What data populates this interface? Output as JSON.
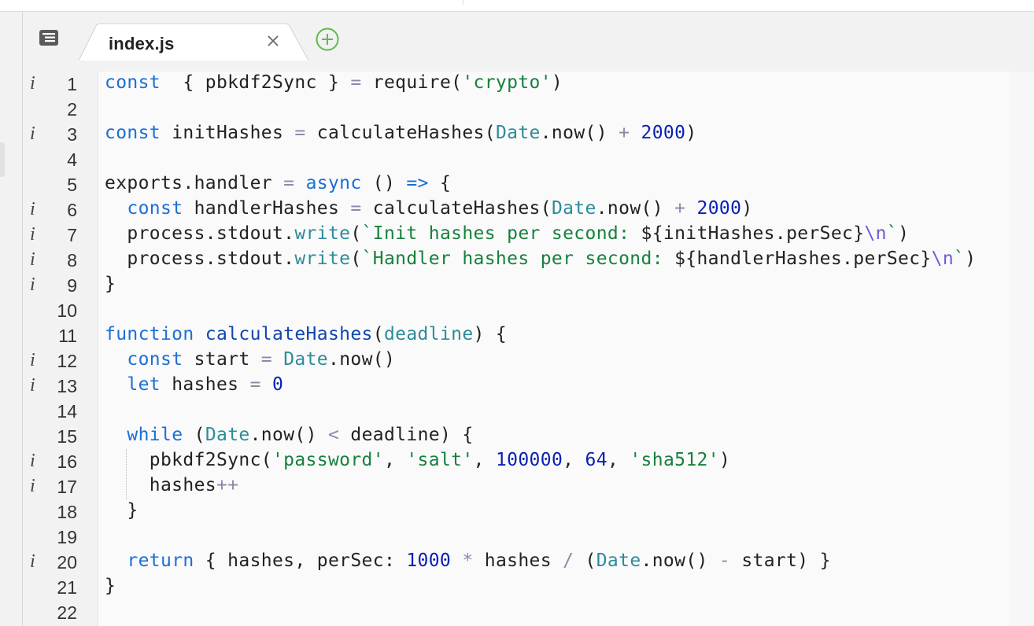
{
  "tabs": [
    {
      "label": "index.js",
      "active": true
    }
  ],
  "icons": {
    "tabs_menu": "list-menu-icon",
    "close": "close-icon",
    "add": "add-tab-icon",
    "info": "info-icon"
  },
  "colors": {
    "keyword": "#1b6fd6",
    "string": "#17803d",
    "number": "#0a1fb3",
    "function": "#1146b0",
    "builtin": "#2c8c99",
    "add_icon": "#5dbb4b"
  },
  "editor": {
    "info_marker": "i",
    "lines": [
      {
        "n": "1",
        "info": true,
        "tokens": [
          [
            "kw",
            "const"
          ],
          [
            "",
            "  { pbkdf2Sync } "
          ],
          [
            "op",
            "="
          ],
          [
            "",
            " require("
          ],
          [
            "str",
            "'crypto'"
          ],
          [
            "",
            ")"
          ]
        ]
      },
      {
        "n": "2",
        "info": false,
        "tokens": []
      },
      {
        "n": "3",
        "info": true,
        "tokens": [
          [
            "kw",
            "const"
          ],
          [
            "",
            " initHashes "
          ],
          [
            "op",
            "="
          ],
          [
            "",
            " calculateHashes("
          ],
          [
            "cls",
            "Date"
          ],
          [
            "",
            ".now() "
          ],
          [
            "op",
            "+"
          ],
          [
            "",
            " "
          ],
          [
            "num",
            "2000"
          ],
          [
            "",
            ")"
          ]
        ]
      },
      {
        "n": "4",
        "info": false,
        "tokens": []
      },
      {
        "n": "5",
        "info": false,
        "tokens": [
          [
            "",
            "exports.handler "
          ],
          [
            "op",
            "="
          ],
          [
            "",
            " "
          ],
          [
            "kw",
            "async"
          ],
          [
            "",
            " () "
          ],
          [
            "kw",
            "=>"
          ],
          [
            "",
            " {"
          ]
        ]
      },
      {
        "n": "6",
        "info": true,
        "tokens": [
          [
            "",
            "  "
          ],
          [
            "kw",
            "const"
          ],
          [
            "",
            " handlerHashes "
          ],
          [
            "op",
            "="
          ],
          [
            "",
            " calculateHashes("
          ],
          [
            "cls",
            "Date"
          ],
          [
            "",
            ".now() "
          ],
          [
            "op",
            "+"
          ],
          [
            "",
            " "
          ],
          [
            "num",
            "2000"
          ],
          [
            "",
            ")"
          ]
        ]
      },
      {
        "n": "7",
        "info": true,
        "tokens": [
          [
            "",
            "  process.stdout."
          ],
          [
            "prm",
            "write"
          ],
          [
            "",
            "("
          ],
          [
            "str",
            "`Init hashes per second: "
          ],
          [
            "",
            "${initHashes.perSec}"
          ],
          [
            "esc",
            "\\n"
          ],
          [
            "str",
            "`"
          ],
          [
            "",
            ")"
          ]
        ]
      },
      {
        "n": "8",
        "info": true,
        "tokens": [
          [
            "",
            "  process.stdout."
          ],
          [
            "prm",
            "write"
          ],
          [
            "",
            "("
          ],
          [
            "str",
            "`Handler hashes per second: "
          ],
          [
            "",
            "${handlerHashes.perSec}"
          ],
          [
            "esc",
            "\\n"
          ],
          [
            "str",
            "`"
          ],
          [
            "",
            ")"
          ]
        ]
      },
      {
        "n": "9",
        "info": true,
        "tokens": [
          [
            "",
            "}"
          ]
        ]
      },
      {
        "n": "10",
        "info": false,
        "tokens": []
      },
      {
        "n": "11",
        "info": false,
        "tokens": [
          [
            "kw",
            "function"
          ],
          [
            "",
            " "
          ],
          [
            "fnc",
            "calculateHashes"
          ],
          [
            "",
            "("
          ],
          [
            "prm",
            "deadline"
          ],
          [
            "",
            ") {"
          ]
        ]
      },
      {
        "n": "12",
        "info": true,
        "tokens": [
          [
            "",
            "  "
          ],
          [
            "kw",
            "const"
          ],
          [
            "",
            " start "
          ],
          [
            "op",
            "="
          ],
          [
            "",
            " "
          ],
          [
            "cls",
            "Date"
          ],
          [
            "",
            ".now()"
          ]
        ]
      },
      {
        "n": "13",
        "info": true,
        "tokens": [
          [
            "",
            "  "
          ],
          [
            "kw",
            "let"
          ],
          [
            "",
            " hashes "
          ],
          [
            "op",
            "="
          ],
          [
            "",
            " "
          ],
          [
            "num",
            "0"
          ]
        ]
      },
      {
        "n": "14",
        "info": false,
        "tokens": []
      },
      {
        "n": "15",
        "info": false,
        "tokens": [
          [
            "",
            "  "
          ],
          [
            "kw",
            "while"
          ],
          [
            "",
            " ("
          ],
          [
            "cls",
            "Date"
          ],
          [
            "",
            ".now() "
          ],
          [
            "op",
            "<"
          ],
          [
            "",
            " deadline) {"
          ]
        ]
      },
      {
        "n": "16",
        "info": true,
        "tokens": [
          [
            "",
            "    pbkdf2Sync("
          ],
          [
            "str",
            "'password'"
          ],
          [
            "",
            ", "
          ],
          [
            "str",
            "'salt'"
          ],
          [
            "",
            ", "
          ],
          [
            "num",
            "100000"
          ],
          [
            "",
            ", "
          ],
          [
            "num",
            "64"
          ],
          [
            "",
            ", "
          ],
          [
            "str",
            "'sha512'"
          ],
          [
            "",
            ")"
          ]
        ]
      },
      {
        "n": "17",
        "info": true,
        "tokens": [
          [
            "",
            "    hashes"
          ],
          [
            "op",
            "++"
          ]
        ]
      },
      {
        "n": "18",
        "info": false,
        "tokens": [
          [
            "",
            "  }"
          ]
        ]
      },
      {
        "n": "19",
        "info": false,
        "tokens": []
      },
      {
        "n": "20",
        "info": true,
        "tokens": [
          [
            "",
            "  "
          ],
          [
            "kw",
            "return"
          ],
          [
            "",
            " { hashes, perSec: "
          ],
          [
            "num",
            "1000"
          ],
          [
            "",
            " "
          ],
          [
            "op",
            "*"
          ],
          [
            "",
            " hashes "
          ],
          [
            "op",
            "/"
          ],
          [
            "",
            " ("
          ],
          [
            "cls",
            "Date"
          ],
          [
            "",
            ".now() "
          ],
          [
            "op",
            "-"
          ],
          [
            "",
            " start) }"
          ]
        ]
      },
      {
        "n": "21",
        "info": false,
        "tokens": [
          [
            "",
            "}"
          ]
        ]
      },
      {
        "n": "22",
        "info": false,
        "tokens": []
      }
    ]
  }
}
